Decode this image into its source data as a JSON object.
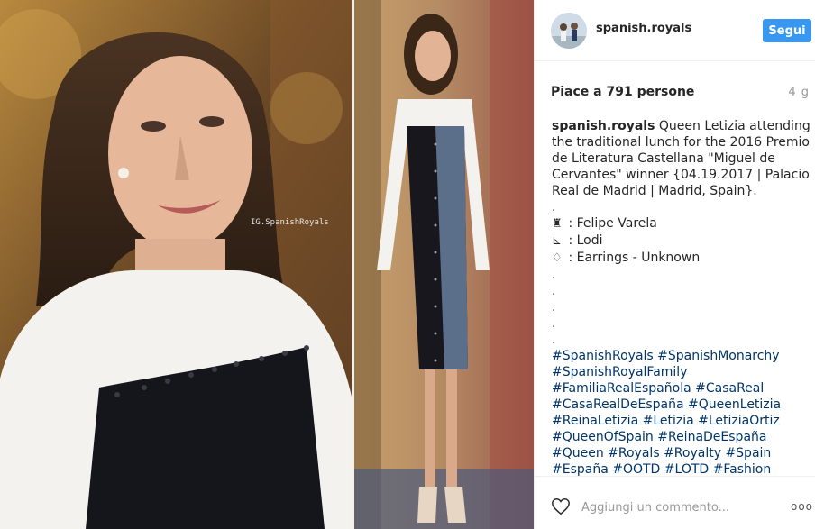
{
  "header": {
    "username": "spanish.royals",
    "follow_label": "Segui"
  },
  "watermark": "IG.SpanishRoyals",
  "post": {
    "likes": "Piace a 791 persone",
    "time": "4 g",
    "caption": {
      "author": "spanish.royals",
      "lines": [
        " Queen Letizia attending",
        "the traditional lunch for the 2016 Premio",
        "de Literatura Castellana \"Miguel de",
        "Cervantes\" winner {04.19.2017 | Palacio",
        "Real de Madrid | Madrid, Spain}.",
        "."
      ],
      "credits": [
        {
          "icon": "dress-icon",
          "glyph": "♜",
          "text": ": Felipe Varela"
        },
        {
          "icon": "shoe-icon",
          "glyph": "⊾",
          "text": ": Lodi"
        },
        {
          "icon": "diamond-icon",
          "glyph": "♢",
          "text": ": Earrings - Unknown"
        }
      ],
      "dots": [
        ".",
        ".",
        ".",
        ".",
        "."
      ],
      "hashtag_lines": [
        "#SpanishRoyals #SpanishMonarchy",
        "#SpanishRoyalFamily",
        "#FamiliaRealEspañola #CasaReal",
        "#CasaRealDeEspaña #QueenLetizia",
        "#ReinaLetizia #Letizia #LetiziaOrtiz",
        "#QueenOfSpain #ReinaDeEspaña",
        "#Queen #Royals #Royalty #Spain",
        "#España #OOTD #LOTD #Fashion"
      ]
    }
  },
  "footer": {
    "comment_placeholder": "Aggiungi un commento...",
    "more_label": "ooo"
  },
  "colors": {
    "follow": "#3897f0",
    "hashtag": "#003569",
    "muted": "#999999"
  }
}
